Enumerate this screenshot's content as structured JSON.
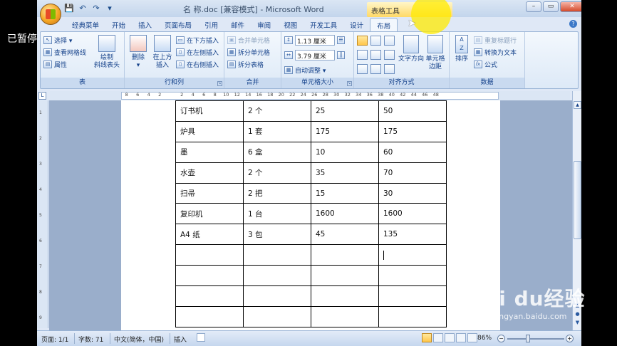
{
  "overlay": {
    "paused_label": "已暂停"
  },
  "watermark": {
    "main": "Bai du经验",
    "sub": "jingyan.baidu.com"
  },
  "window": {
    "document_title": "名 称.doc [兼容模式] - Microsoft Word",
    "contextual_tab": "表格工具",
    "controls": {
      "minimize": "–",
      "restore": "▭",
      "close": "✕"
    }
  },
  "quick_access": {
    "save": "💾",
    "undo": "↶",
    "redo": "↷",
    "customize": "▾"
  },
  "tabs": [
    "经典菜单",
    "开始",
    "插入",
    "页面布局",
    "引用",
    "邮件",
    "审阅",
    "视图",
    "开发工具",
    "设计",
    "布局"
  ],
  "active_tab": "布局",
  "ribbon": {
    "table": {
      "label": "表",
      "select": "选择 ▾",
      "view_gridlines": "查看网格线",
      "properties": "属性",
      "draw_diagonal_line1": "绘制",
      "draw_diagonal_line2": "斜线表头"
    },
    "rows_columns": {
      "label": "行和列",
      "delete": "删除",
      "delete_arrow": "▾",
      "insert_above1": "在上方",
      "insert_above2": "插入",
      "insert_below": "在下方插入",
      "insert_left": "在左侧插入",
      "insert_right": "在右侧插入"
    },
    "merge": {
      "label": "合并",
      "merge_cells": "合并单元格",
      "split_cells": "拆分单元格",
      "split_table": "拆分表格"
    },
    "cell_size": {
      "label": "单元格大小",
      "height": "1.13 厘米",
      "width": "3.79 厘米",
      "autofit": "自动调整 ▾"
    },
    "alignment": {
      "label": "对齐方式",
      "text_direction1": "文字方向",
      "cell_margins1": "单元格",
      "cell_margins2": "边距"
    },
    "data": {
      "label": "数据",
      "sort": "排序",
      "repeat_header": "重复标题行",
      "convert_to_text": "转换为文本",
      "formula": "公式"
    }
  },
  "ruler": {
    "h_ticks": [
      "8",
      "6",
      "4",
      "2",
      "",
      "2",
      "4",
      "6",
      "8",
      "10",
      "12",
      "14",
      "16",
      "18",
      "20",
      "22",
      "24",
      "26",
      "28",
      "30",
      "32",
      "34",
      "36",
      "38",
      "40",
      "42",
      "44",
      "46",
      "48"
    ],
    "v_marks": [
      "1",
      "2",
      "3",
      "4",
      "5",
      "6",
      "7",
      "8",
      "9"
    ]
  },
  "table": {
    "rows": [
      [
        "订书机",
        "2 个",
        "25",
        "50"
      ],
      [
        "炉具",
        "1 套",
        "175",
        "175"
      ],
      [
        "墨",
        "6 盒",
        "10",
        "60"
      ],
      [
        "水壶",
        "2 个",
        "35",
        "70"
      ],
      [
        "扫帚",
        "2 把",
        "15",
        "30"
      ],
      [
        "复印机",
        "1 台",
        "1600",
        "1600"
      ],
      [
        "A4 纸",
        "3 包",
        "45",
        "135"
      ],
      [
        "",
        "",
        "",
        ""
      ],
      [
        "",
        "",
        "",
        ""
      ],
      [
        "",
        "",
        "",
        ""
      ],
      [
        "",
        "",
        "",
        ""
      ]
    ]
  },
  "status": {
    "page": "页面: 1/1",
    "words": "字数: 71",
    "language": "中文(简体，中国)",
    "mode": "插入",
    "zoom": "86%",
    "zoom_minus": "−",
    "zoom_plus": "+"
  }
}
